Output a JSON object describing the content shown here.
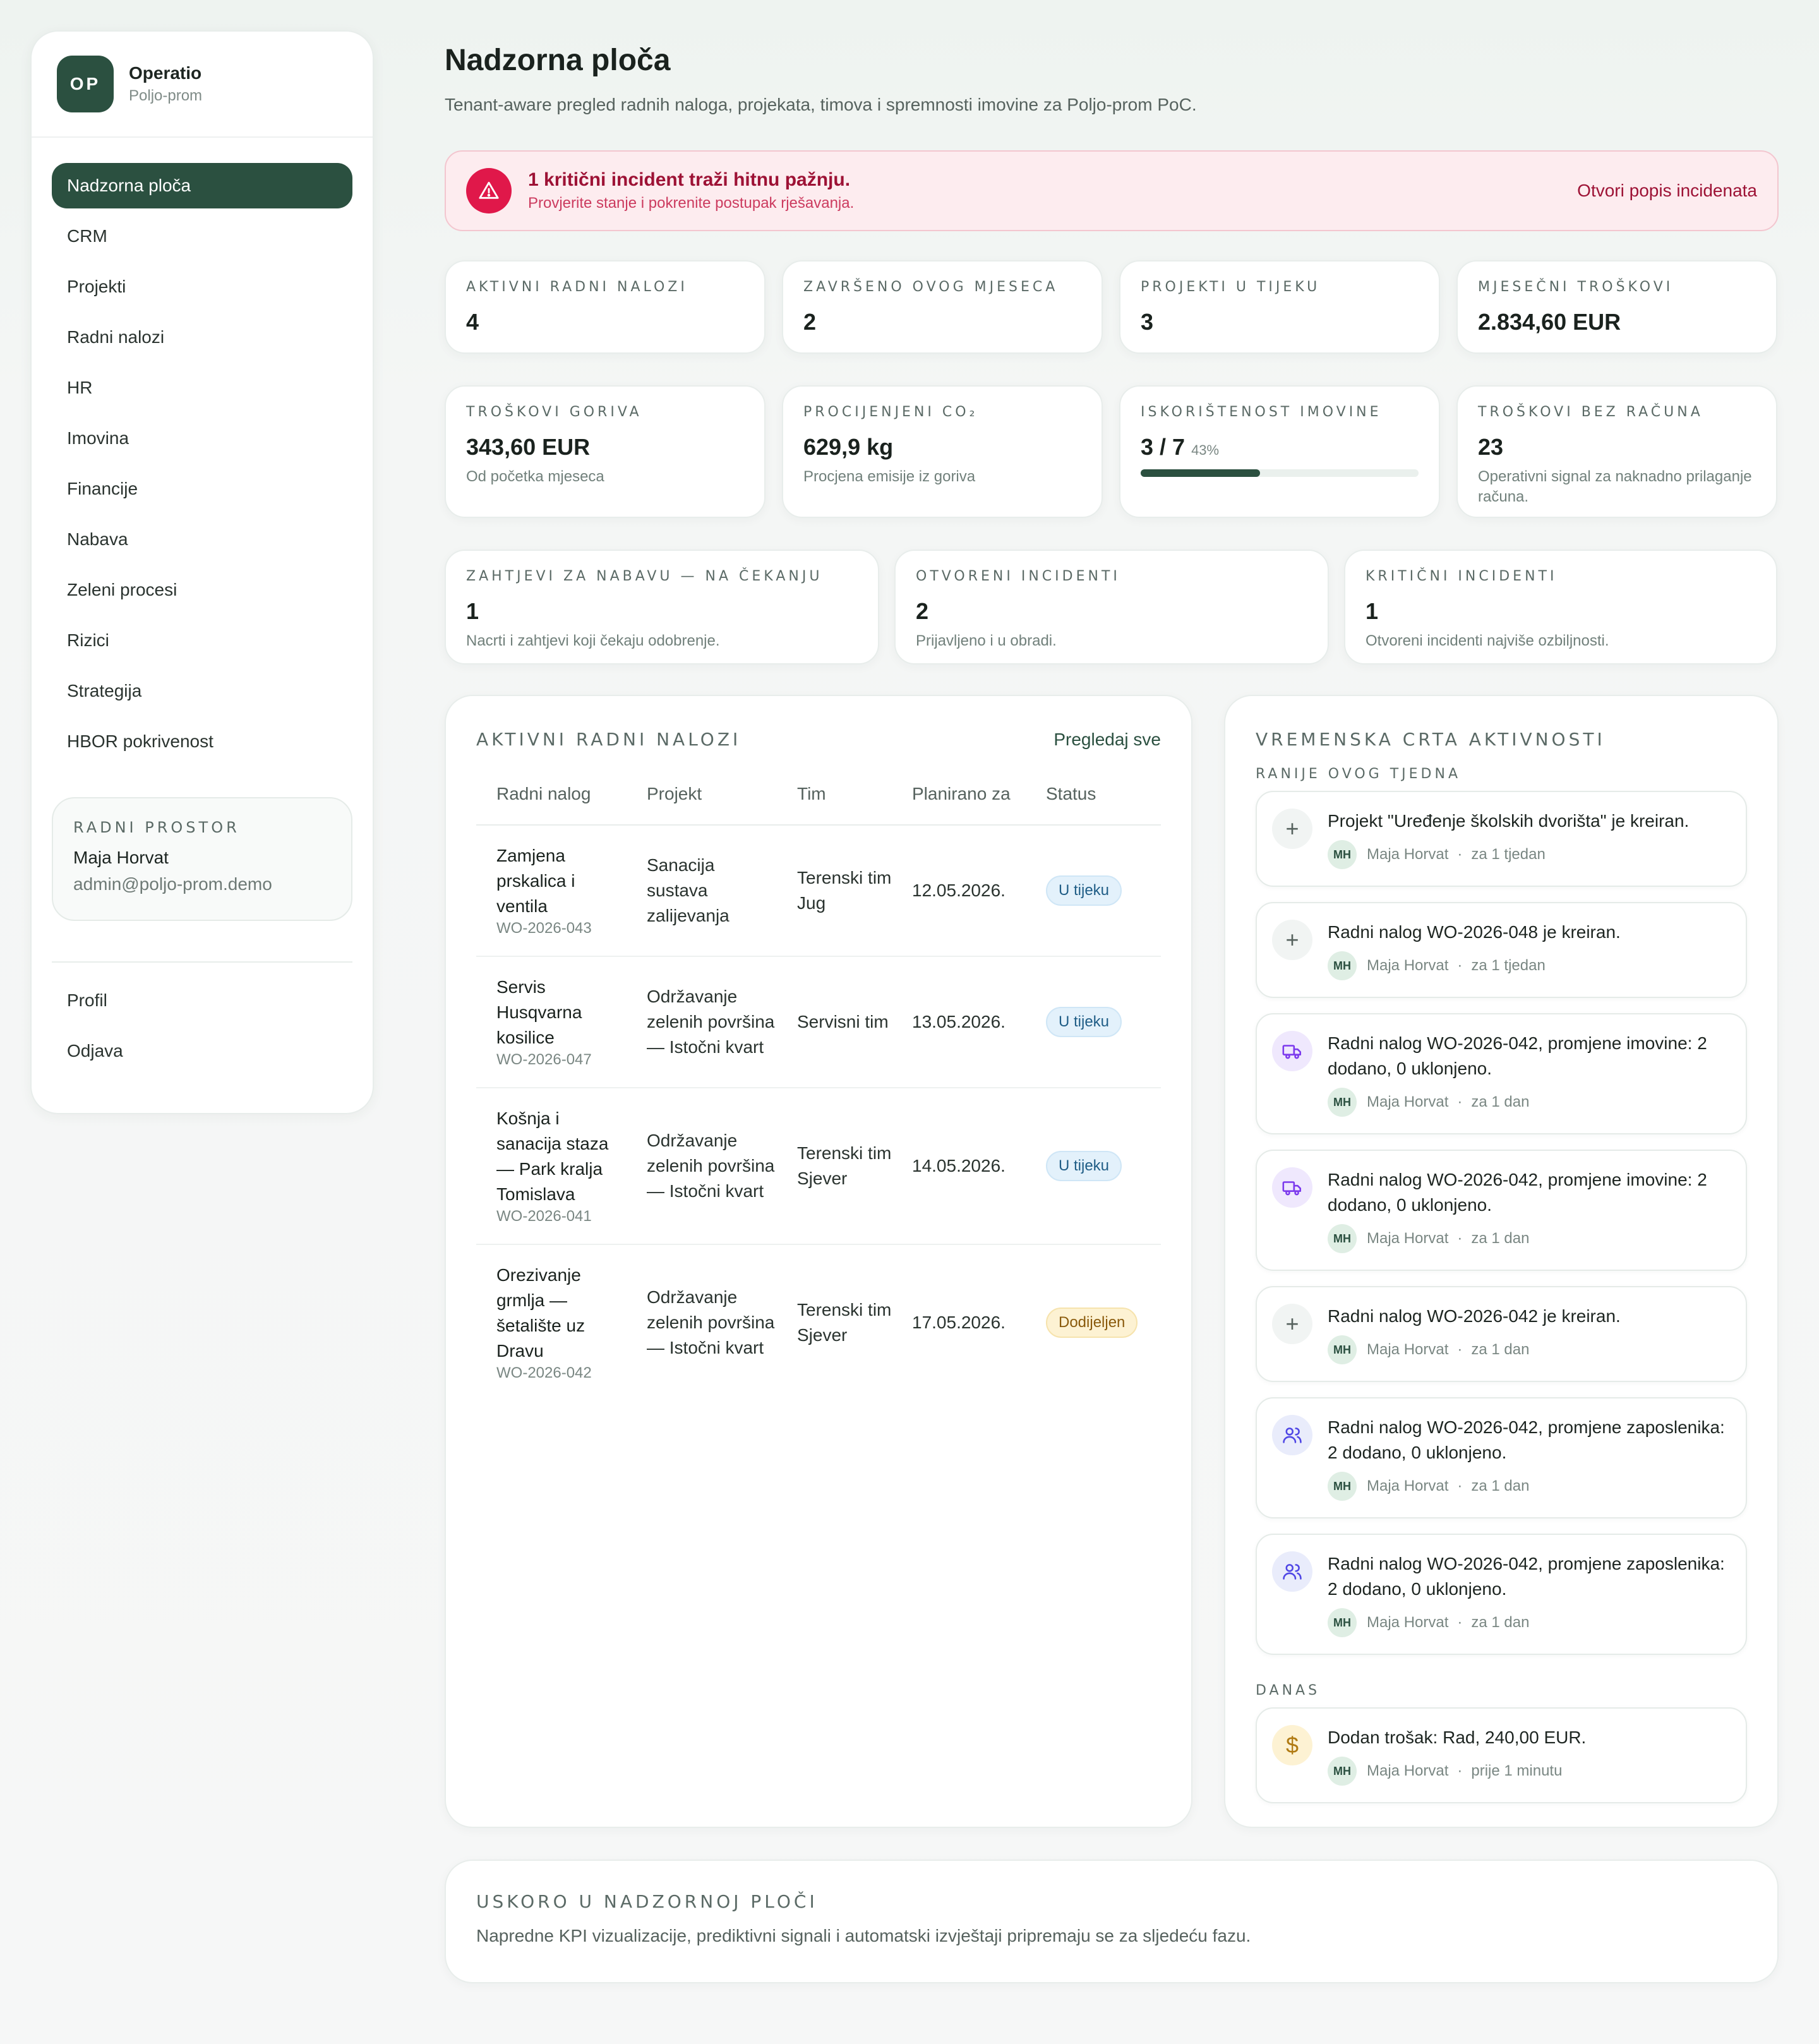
{
  "brand": {
    "initials": "OP",
    "name": "Operatio",
    "tenant": "Poljo-prom"
  },
  "nav": {
    "items": [
      {
        "label": "Nadzorna ploča",
        "active": true
      },
      {
        "label": "CRM"
      },
      {
        "label": "Projekti"
      },
      {
        "label": "Radni nalozi"
      },
      {
        "label": "HR"
      },
      {
        "label": "Imovina"
      },
      {
        "label": "Financije"
      },
      {
        "label": "Nabava"
      },
      {
        "label": "Zeleni procesi"
      },
      {
        "label": "Rizici"
      },
      {
        "label": "Strategija"
      },
      {
        "label": "HBOR pokrivenost"
      }
    ],
    "footer": [
      {
        "label": "Profil"
      },
      {
        "label": "Odjava"
      }
    ]
  },
  "workspace": {
    "label": "Radni prostor",
    "user": "Maja Horvat",
    "email": "admin@poljo-prom.demo"
  },
  "page": {
    "title": "Nadzorna ploča",
    "subtitle": "Tenant-aware pregled radnih naloga, projekata, timova i spremnosti imovine za Poljo-prom PoC."
  },
  "alert": {
    "icon": "warning-triangle-icon",
    "title": "1 kritični incident traži hitnu pažnju.",
    "description": "Provjerite stanje i pokrenite postupak rješavanja.",
    "link": "Otvori popis incidenata",
    "color": "#e0184a"
  },
  "stats": {
    "active_orders": {
      "label": "Aktivni radni nalozi",
      "value": "4"
    },
    "completed": {
      "label": "Završeno ovog mjeseca",
      "value": "2"
    },
    "projects": {
      "label": "Projekti u tijeku",
      "value": "3"
    },
    "monthly_costs": {
      "label": "Mjesečni troškovi",
      "value": "2.834,60 EUR"
    },
    "fuel": {
      "label": "Troškovi goriva",
      "value": "343,60 EUR",
      "note": "Od početka mjeseca"
    },
    "co2": {
      "label": "Procijenjeni CO₂",
      "value": "629,9 kg",
      "note": "Procjena emisije iz goriva"
    },
    "assets": {
      "label": "Iskorištenost imovine",
      "value": "3 / 7",
      "pct": "43%",
      "fraction": 0.43
    },
    "unbilled": {
      "label": "Troškovi bez računa",
      "value": "23",
      "note": "Operativni signal za naknadno prilaganje računa."
    },
    "procurement": {
      "label": "Zahtjevi za nabavu — na čekanju",
      "value": "1",
      "note": "Nacrti i zahtjevi koji čekaju odobrenje."
    },
    "open_incidents": {
      "label": "Otvoreni incidenti",
      "value": "2",
      "note": "Prijavljeno i u obradi."
    },
    "critical_incidents": {
      "label": "Kritični incidenti",
      "value": "1",
      "note": "Otvoreni incidenti najviše ozbiljnosti."
    }
  },
  "work_orders": {
    "title": "Aktivni radni nalozi",
    "view_all": "Pregledaj sve",
    "columns": [
      "Radni nalog",
      "Projekt",
      "Tim",
      "Planirano za",
      "Status"
    ],
    "rows": [
      {
        "name": "Zamjena prskalica i ventila",
        "code": "WO-2026-043",
        "project": "Sanacija sustava zalijevanja",
        "team": "Terenski tim Jug",
        "date": "12.05.2026.",
        "status": "U tijeku"
      },
      {
        "name": "Servis Husqvarna kosilice",
        "code": "WO-2026-047",
        "project": "Održavanje zelenih površina — Istočni kvart",
        "team": "Servisni tim",
        "date": "13.05.2026.",
        "status": "U tijeku"
      },
      {
        "name": "Košnja i sanacija staza — Park kralja Tomislava",
        "code": "WO-2026-041",
        "project": "Održavanje zelenih površina — Istočni kvart",
        "team": "Terenski tim Sjever",
        "date": "14.05.2026.",
        "status": "U tijeku"
      },
      {
        "name": "Orezivanje grmlja — šetalište uz Dravu",
        "code": "WO-2026-042",
        "project": "Održavanje zelenih površina — Istočni kvart",
        "team": "Terenski tim Sjever",
        "date": "17.05.2026.",
        "status": "Dodijeljen"
      }
    ]
  },
  "timeline": {
    "title": "Vremenska crta aktivnosti",
    "group_week": "Ranije ovog tjedna",
    "group_today": "Danas",
    "week": [
      {
        "icon": "plus-icon",
        "text": "Projekt \"Uređenje školskih dvorišta\" je kreiran.",
        "initials": "MH",
        "user": "Maja Horvat",
        "time": "za 1 tjedan"
      },
      {
        "icon": "plus-icon",
        "text": "Radni nalog WO-2026-048 je kreiran.",
        "initials": "MH",
        "user": "Maja Horvat",
        "time": "za 1 tjedan"
      },
      {
        "icon": "truck-icon",
        "text": "Radni nalog WO-2026-042, promjene imovine: 2 dodano, 0 uklonjeno.",
        "initials": "MH",
        "user": "Maja Horvat",
        "time": "za 1 dan"
      },
      {
        "icon": "truck-icon",
        "text": "Radni nalog WO-2026-042, promjene imovine: 2 dodano, 0 uklonjeno.",
        "initials": "MH",
        "user": "Maja Horvat",
        "time": "za 1 dan"
      },
      {
        "icon": "plus-icon",
        "text": "Radni nalog WO-2026-042 je kreiran.",
        "initials": "MH",
        "user": "Maja Horvat",
        "time": "za 1 dan"
      },
      {
        "icon": "users-icon",
        "text": "Radni nalog WO-2026-042, promjene zaposlenika: 2 dodano, 0 uklonjeno.",
        "initials": "MH",
        "user": "Maja Horvat",
        "time": "za 1 dan"
      },
      {
        "icon": "users-icon",
        "text": "Radni nalog WO-2026-042, promjene zaposlenika: 2 dodano, 0 uklonjeno.",
        "initials": "MH",
        "user": "Maja Horvat",
        "time": "za 1 dan"
      }
    ],
    "today": [
      {
        "icon": "dollar-icon",
        "text": "Dodan trošak: Rad, 240,00 EUR.",
        "initials": "MH",
        "user": "Maja Horvat",
        "time": "prije 1 minutu"
      }
    ]
  },
  "coming_soon": {
    "title": "Uskoro u nadzornoj ploči",
    "text": "Napredne KPI vizualizacije, prediktivni signali i automatski izvještaji pripremaju se za sljedeću fazu."
  },
  "colors": {
    "primary": "#2b5040",
    "danger": "#e0184a",
    "info_badge": "#e3f1fb",
    "warn_badge": "#fdf2d3"
  }
}
